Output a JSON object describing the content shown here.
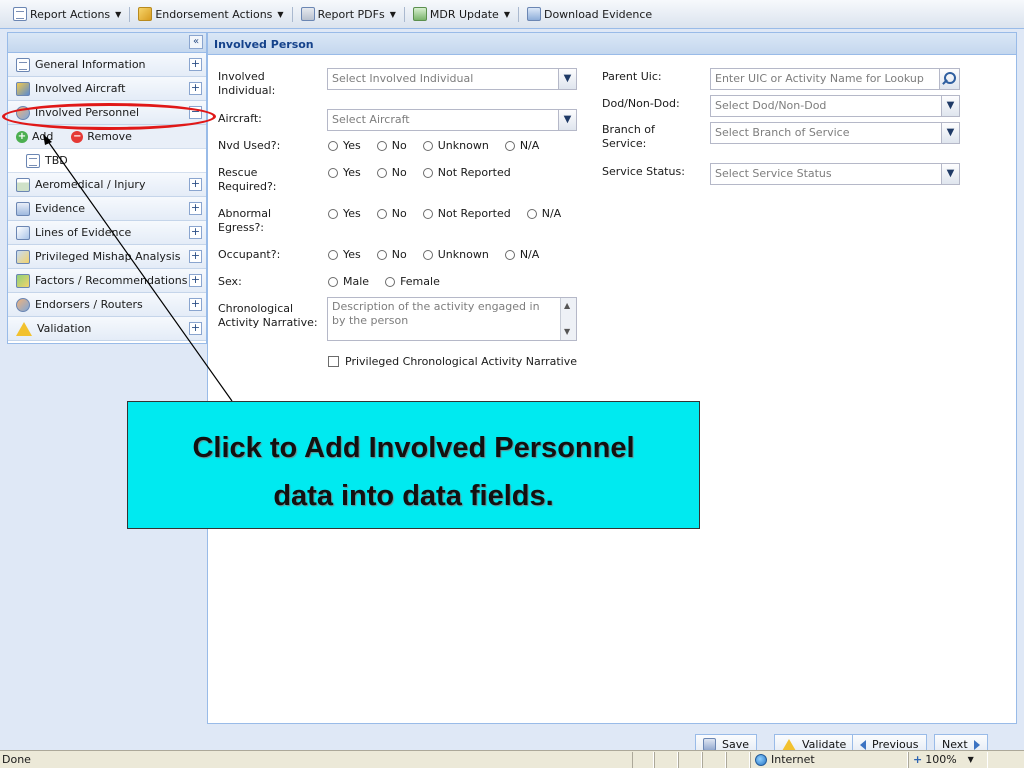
{
  "toolbar": {
    "items": [
      {
        "label": "Report Actions",
        "icon": "report-icon",
        "dropdown": true
      },
      {
        "label": "Endorsement Actions",
        "icon": "pen-icon",
        "dropdown": true
      },
      {
        "label": "Report PDFs",
        "icon": "printer-icon",
        "dropdown": true
      },
      {
        "label": "MDR Update",
        "icon": "mdr-icon",
        "dropdown": true
      },
      {
        "label": "Download Evidence",
        "icon": "download-icon",
        "dropdown": false
      }
    ]
  },
  "sidebar": {
    "collapse_label": "«",
    "items": [
      {
        "label": "General Information",
        "toggle": "+",
        "icon": "document-icon"
      },
      {
        "label": "Involved Aircraft",
        "toggle": "+",
        "icon": "aircraft-icon"
      },
      {
        "label": "Involved Personnel",
        "toggle": "−",
        "icon": "people-icon"
      },
      {
        "label": "Aeromedical / Injury",
        "toggle": "+",
        "icon": "calendar-icon"
      },
      {
        "label": "Evidence",
        "toggle": "+",
        "icon": "evidence-icon"
      },
      {
        "label": "Lines of Evidence",
        "toggle": "+",
        "icon": "lines-icon"
      },
      {
        "label": "Privileged Mishap Analysis",
        "toggle": "+",
        "icon": "privileged-icon"
      },
      {
        "label": "Factors / Recommendations",
        "toggle": "+",
        "icon": "factors-icon"
      },
      {
        "label": "Endorsers / Routers",
        "toggle": "+",
        "icon": "endorsers-icon"
      },
      {
        "label": "Validation",
        "toggle": "+",
        "icon": "warning-icon"
      }
    ],
    "sub_actions": {
      "add": "Add",
      "remove": "Remove"
    },
    "leaf": "TBD"
  },
  "main": {
    "title": "Involved Person",
    "fields": {
      "involved_individual": {
        "label": "Involved Individual:",
        "placeholder": "Select Involved Individual"
      },
      "aircraft": {
        "label": "Aircraft:",
        "placeholder": "Select Aircraft"
      },
      "nvd_used": {
        "label": "Nvd Used?:",
        "options": [
          "Yes",
          "No",
          "Unknown",
          "N/A"
        ]
      },
      "rescue_required": {
        "label": "Rescue Required?:",
        "options": [
          "Yes",
          "No",
          "Not Reported"
        ]
      },
      "abnormal_egress": {
        "label": "Abnormal Egress?:",
        "options": [
          "Yes",
          "No",
          "Not Reported",
          "N/A"
        ]
      },
      "occupant": {
        "label": "Occupant?:",
        "options": [
          "Yes",
          "No",
          "Unknown",
          "N/A"
        ]
      },
      "sex": {
        "label": "Sex:",
        "options": [
          "Male",
          "Female"
        ]
      },
      "chronological_narrative": {
        "label": "Chronological Activity Narrative:",
        "placeholder": "Description of the activity engaged in by the person"
      },
      "privileged_narrative": {
        "label": "Privileged Chronological Activity Narrative"
      },
      "parent_uic": {
        "label": "Parent Uic:",
        "placeholder": "Enter UIC or Activity Name for Lookup"
      },
      "dod_non_dod": {
        "label": "Dod/Non-Dod:",
        "placeholder": "Select Dod/Non-Dod"
      },
      "branch_of_service": {
        "label": "Branch of Service:",
        "placeholder": "Select Branch of Service"
      },
      "service_status": {
        "label": "Service Status:",
        "placeholder": "Select Service Status"
      }
    }
  },
  "callout": {
    "line1": "Click to Add Involved Personnel",
    "line2": "data into data fields."
  },
  "buttons": {
    "save": "Save",
    "validate": "Validate",
    "previous": "Previous",
    "next": "Next"
  },
  "statusbar": {
    "status": "Done",
    "zone": "Internet",
    "zoom": "100%"
  },
  "colors": {
    "callout_bg": "#00eaf0",
    "highlight": "#e01818",
    "header_text": "#15428b"
  }
}
